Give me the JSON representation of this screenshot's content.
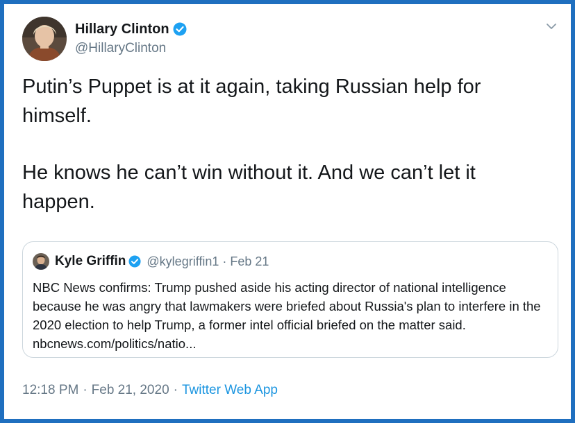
{
  "tweet": {
    "author": {
      "name": "Hillary Clinton",
      "handle": "@HillaryClinton",
      "verified_icon": "verified-badge-icon",
      "avatar_icon": "avatar-photo"
    },
    "more_icon": "chevron-down-icon",
    "text": {
      "paragraph_1": "Putin’s Puppet is at it again, taking Russian help for himself.",
      "paragraph_2": "He knows he can’t win without it. And we can’t let it happen."
    },
    "quoted": {
      "name": "Kyle Griffin",
      "handle": "@kylegriffin1",
      "separator": "·",
      "date": "Feb 21",
      "text": "NBC News confirms: Trump pushed aside his acting director of national intelligence because he was angry that lawmakers were briefed about Russia's plan to interfere in the 2020 election to help Trump, a former intel official briefed on the matter said. nbcnews.com/politics/natio..."
    },
    "footer": {
      "time": "12:18 PM",
      "separator_1": "·",
      "date": "Feb 21, 2020",
      "separator_2": "·",
      "app": "Twitter Web App"
    }
  },
  "colors": {
    "frame_border": "#1f6fbf",
    "verified": "#1da1f2",
    "link": "#1b95e0",
    "secondary_text": "#657786",
    "primary_text": "#14171a"
  }
}
